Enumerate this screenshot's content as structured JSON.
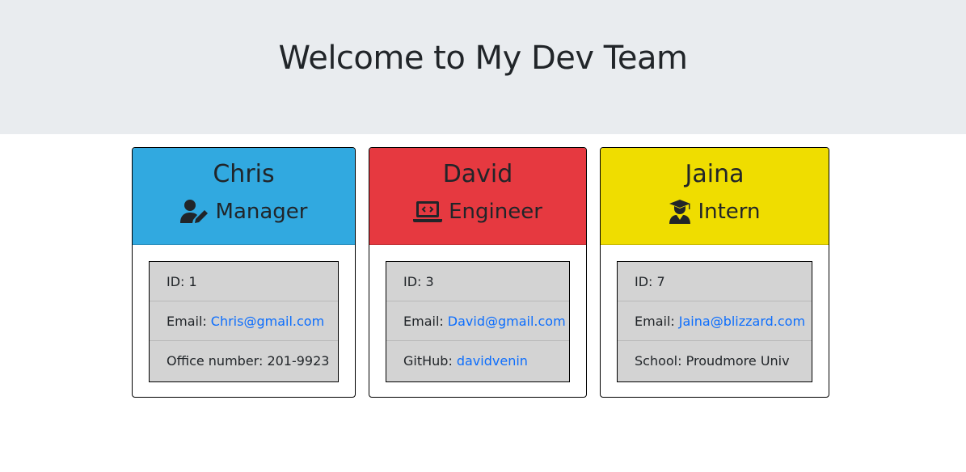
{
  "header": {
    "title": "Welcome to My Dev Team",
    "background": "#e9ecef"
  },
  "team": [
    {
      "name": "Chris",
      "role": "Manager",
      "role_icon": "user-pen-icon",
      "color": "#31a9e0",
      "id_label": "ID:",
      "id": "1",
      "email_label": "Email:",
      "email": "Chris@gmail.com",
      "extra_label": "Office number:",
      "extra_value": "201-9923"
    },
    {
      "name": "David",
      "role": "Engineer",
      "role_icon": "laptop-code-icon",
      "color": "#e63940",
      "id_label": "ID:",
      "id": "3",
      "email_label": "Email:",
      "email": "David@gmail.com",
      "extra_label": "GitHub:",
      "extra_value": "davidvenin"
    },
    {
      "name": "Jaina",
      "role": "Intern",
      "role_icon": "user-graduate-icon",
      "color": "#efdd00",
      "id_label": "ID:",
      "id": "7",
      "email_label": "Email:",
      "email": "Jaina@blizzard.com",
      "extra_label": "School:",
      "extra_value": "Proudmore Univ"
    }
  ],
  "link_color": "#0d6efd"
}
